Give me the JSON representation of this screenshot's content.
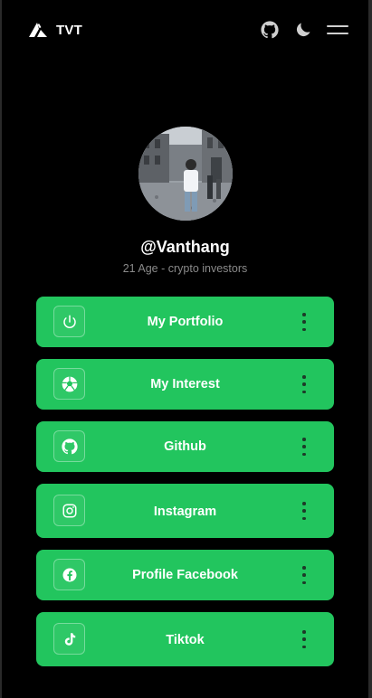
{
  "header": {
    "brand_name": "TVT",
    "icons": [
      "logo-triangle-icon",
      "github-icon",
      "moon-icon",
      "menu-icon"
    ]
  },
  "profile": {
    "handle": "@Vanthang",
    "bio": "21 Age - crypto investors"
  },
  "links": [
    {
      "label": "My Portfolio",
      "icon": "power-icon"
    },
    {
      "label": "My Interest",
      "icon": "soccer-ball-icon"
    },
    {
      "label": "Github",
      "icon": "github-icon"
    },
    {
      "label": "Instagram",
      "icon": "instagram-icon"
    },
    {
      "label": "Profile Facebook",
      "icon": "facebook-icon"
    },
    {
      "label": "Tiktok",
      "icon": "tiktok-icon"
    }
  ],
  "colors": {
    "background": "#000000",
    "button": "#22c55e",
    "text": "#ffffff",
    "muted": "#8a8a8a"
  }
}
